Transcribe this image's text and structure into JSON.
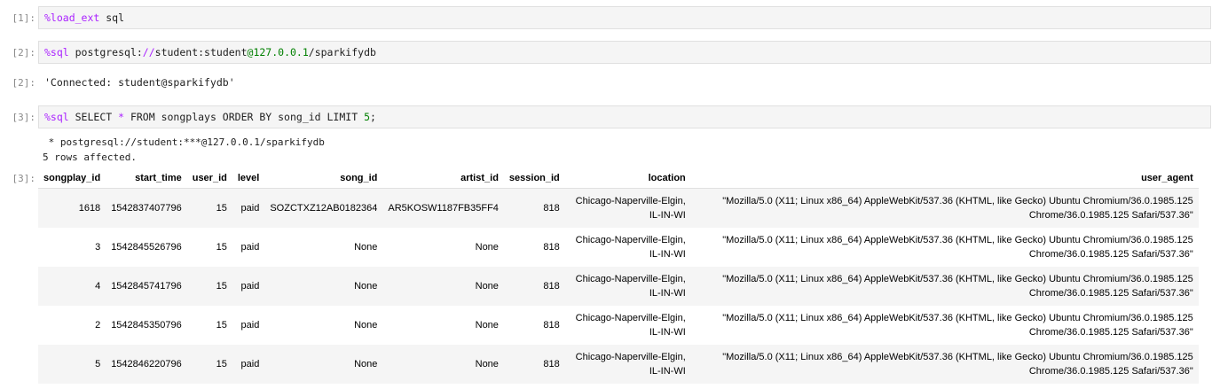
{
  "cells": [
    {
      "prompt": "[1]:",
      "code": [
        {
          "t": "%load_ext",
          "c": "magic"
        },
        {
          "t": " sql",
          "c": "plain"
        }
      ]
    },
    {
      "prompt": "[2]:",
      "code": [
        {
          "t": "%sql",
          "c": "magic"
        },
        {
          "t": " postgresql:",
          "c": "plain"
        },
        {
          "t": "//",
          "c": "op"
        },
        {
          "t": "student:student",
          "c": "plain"
        },
        {
          "t": "@",
          "c": "at"
        },
        {
          "t": "127.0.0.1",
          "c": "num"
        },
        {
          "t": "/sparkifydb",
          "c": "plain"
        }
      ]
    },
    {
      "prompt": "[3]:",
      "code": [
        {
          "t": "%sql",
          "c": "magic"
        },
        {
          "t": " SELECT ",
          "c": "plain"
        },
        {
          "t": "*",
          "c": "op"
        },
        {
          "t": " FROM songplays ORDER BY song_id LIMIT ",
          "c": "plain"
        },
        {
          "t": "5",
          "c": "num"
        },
        {
          "t": ";",
          "c": "plain"
        }
      ]
    }
  ],
  "output2": {
    "prompt": "[2]:",
    "text": "'Connected: student@sparkifydb'"
  },
  "output3": {
    "prompt": "[3]:",
    "conn_line": " * postgresql://student:***@127.0.0.1/sparkifydb",
    "rows_line": "5 rows affected.",
    "columns": [
      "songplay_id",
      "start_time",
      "user_id",
      "level",
      "song_id",
      "artist_id",
      "session_id",
      "location",
      "user_agent"
    ],
    "rows": [
      [
        "1618",
        "1542837407796",
        "15",
        "paid",
        "SOZCTXZ12AB0182364",
        "AR5KOSW1187FB35FF4",
        "818",
        "Chicago-Naperville-Elgin, IL-IN-WI",
        "\"Mozilla/5.0 (X11; Linux x86_64) AppleWebKit/537.36 (KHTML, like Gecko) Ubuntu Chromium/36.0.1985.125 Chrome/36.0.1985.125 Safari/537.36\""
      ],
      [
        "3",
        "1542845526796",
        "15",
        "paid",
        "None",
        "None",
        "818",
        "Chicago-Naperville-Elgin, IL-IN-WI",
        "\"Mozilla/5.0 (X11; Linux x86_64) AppleWebKit/537.36 (KHTML, like Gecko) Ubuntu Chromium/36.0.1985.125 Chrome/36.0.1985.125 Safari/537.36\""
      ],
      [
        "4",
        "1542845741796",
        "15",
        "paid",
        "None",
        "None",
        "818",
        "Chicago-Naperville-Elgin, IL-IN-WI",
        "\"Mozilla/5.0 (X11; Linux x86_64) AppleWebKit/537.36 (KHTML, like Gecko) Ubuntu Chromium/36.0.1985.125 Chrome/36.0.1985.125 Safari/537.36\""
      ],
      [
        "2",
        "1542845350796",
        "15",
        "paid",
        "None",
        "None",
        "818",
        "Chicago-Naperville-Elgin, IL-IN-WI",
        "\"Mozilla/5.0 (X11; Linux x86_64) AppleWebKit/537.36 (KHTML, like Gecko) Ubuntu Chromium/36.0.1985.125 Chrome/36.0.1985.125 Safari/537.36\""
      ],
      [
        "5",
        "1542846220796",
        "15",
        "paid",
        "None",
        "None",
        "818",
        "Chicago-Naperville-Elgin, IL-IN-WI",
        "\"Mozilla/5.0 (X11; Linux x86_64) AppleWebKit/537.36 (KHTML, like Gecko) Ubuntu Chromium/36.0.1985.125 Chrome/36.0.1985.125 Safari/537.36\""
      ]
    ]
  },
  "colors": {
    "magic": "#aa22ff",
    "number": "#008000",
    "prompt": "#8a8a8a",
    "cell_bg": "#f5f5f5"
  }
}
